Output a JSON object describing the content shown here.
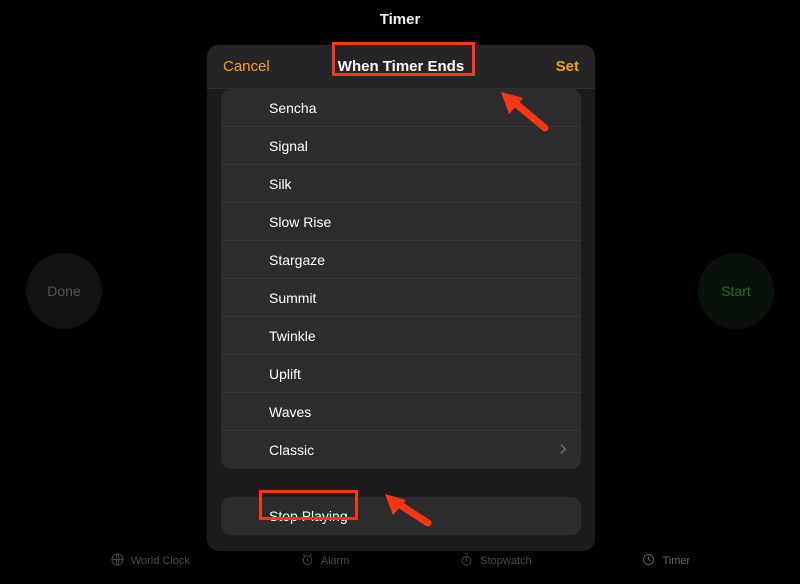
{
  "page": {
    "title": "Timer"
  },
  "controls": {
    "done_label": "Done",
    "start_label": "Start"
  },
  "sheet": {
    "cancel_label": "Cancel",
    "title": "When Timer Ends",
    "set_label": "Set",
    "sounds": [
      {
        "label": "Sencha"
      },
      {
        "label": "Signal"
      },
      {
        "label": "Silk"
      },
      {
        "label": "Slow Rise"
      },
      {
        "label": "Stargaze"
      },
      {
        "label": "Summit"
      },
      {
        "label": "Twinkle"
      },
      {
        "label": "Uplift"
      },
      {
        "label": "Waves"
      },
      {
        "label": "Classic",
        "disclosure": true
      }
    ],
    "stop_label": "Stop Playing"
  },
  "tabs": {
    "world_clock": "World Clock",
    "alarm": "Alarm",
    "stopwatch": "Stopwatch",
    "timer": "Timer"
  },
  "annotations": {
    "highlight_title": true,
    "highlight_stop": true,
    "arrow_color": "#ff3616"
  }
}
